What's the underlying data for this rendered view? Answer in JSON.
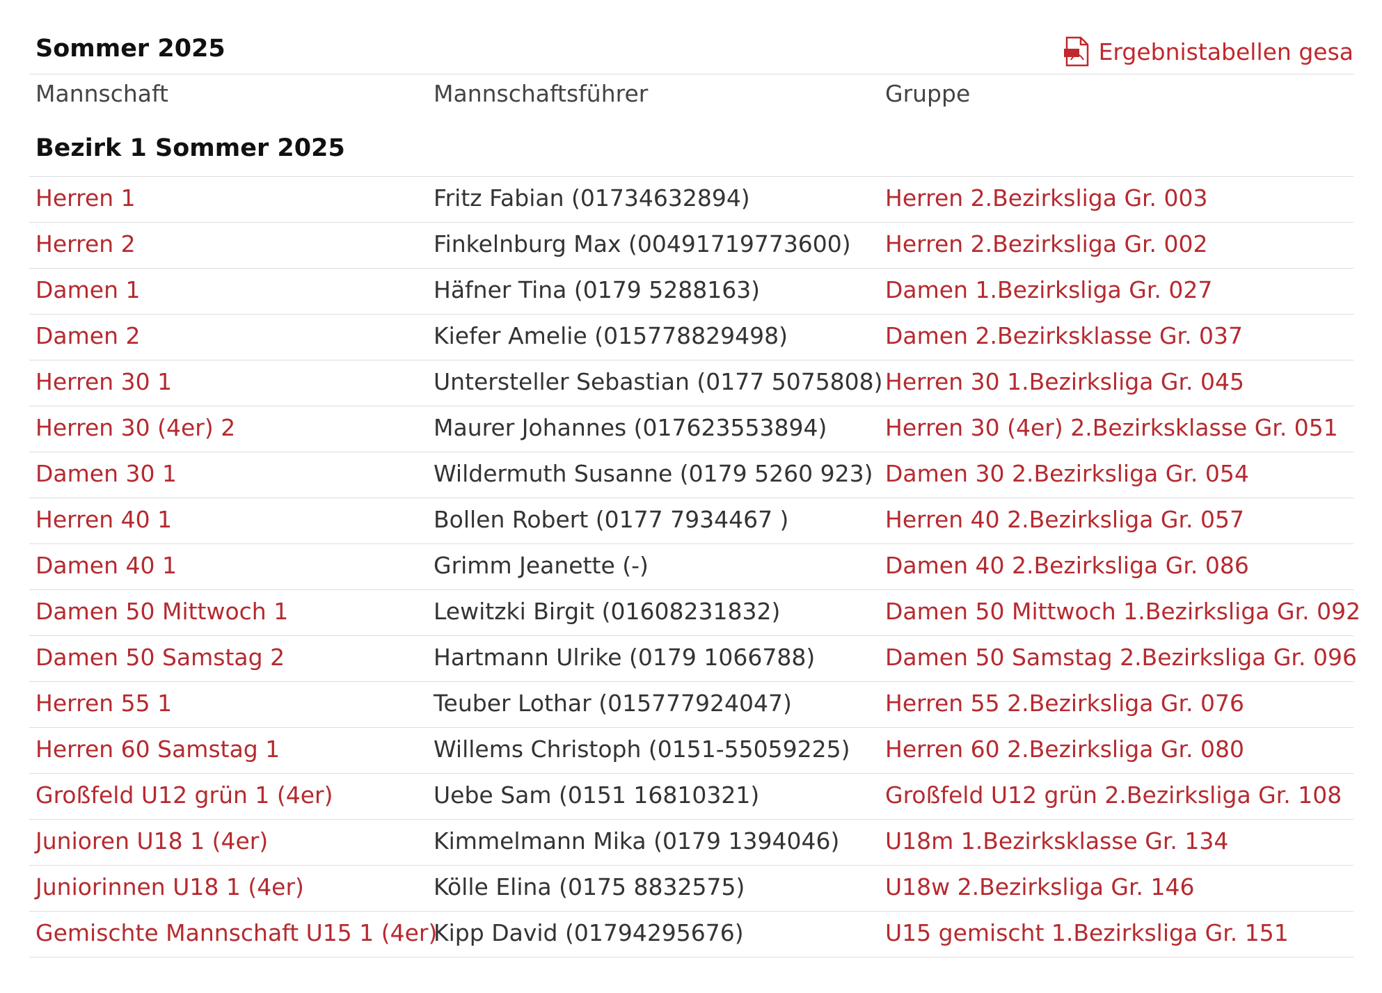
{
  "season": {
    "title": "Sommer 2025",
    "pdf_link_label": "Ergebnistabellen gesa",
    "pdf_icon": "pdf-file-icon"
  },
  "columns": {
    "team": "Mannschaft",
    "captain": "Mannschaftsführer",
    "group": "Gruppe"
  },
  "section": {
    "title": "Bezirk 1 Sommer 2025"
  },
  "rows": [
    {
      "team": "Herren 1",
      "captain": "Fritz Fabian (01734632894)",
      "group": "Herren 2.Bezirksliga Gr. 003"
    },
    {
      "team": "Herren 2",
      "captain": "Finkelnburg Max (00491719773600)",
      "group": "Herren 2.Bezirksliga Gr. 002"
    },
    {
      "team": "Damen 1",
      "captain": "Häfner Tina (0179 5288163)",
      "group": "Damen 1.Bezirksliga Gr. 027"
    },
    {
      "team": "Damen 2",
      "captain": "Kiefer Amelie (015778829498)",
      "group": "Damen 2.Bezirksklasse Gr. 037"
    },
    {
      "team": "Herren 30 1",
      "captain": "Untersteller Sebastian (0177 5075808)",
      "group": "Herren 30 1.Bezirksliga Gr. 045"
    },
    {
      "team": "Herren 30 (4er) 2",
      "captain": "Maurer Johannes (017623553894)",
      "group": "Herren 30 (4er) 2.Bezirksklasse Gr. 051"
    },
    {
      "team": "Damen 30 1",
      "captain": "Wildermuth Susanne (0179 5260 923)",
      "group": "Damen 30 2.Bezirksliga Gr. 054"
    },
    {
      "team": "Herren 40 1",
      "captain": "Bollen Robert (0177 7934467 )",
      "group": "Herren 40 2.Bezirksliga Gr. 057"
    },
    {
      "team": "Damen 40 1",
      "captain": "Grimm Jeanette (-)",
      "group": "Damen 40 2.Bezirksliga Gr. 086"
    },
    {
      "team": "Damen 50 Mittwoch 1",
      "captain": "Lewitzki Birgit (01608231832)",
      "group": "Damen 50 Mittwoch 1.Bezirksliga Gr. 092"
    },
    {
      "team": "Damen 50 Samstag 2",
      "captain": "Hartmann Ulrike (0179 1066788)",
      "group": "Damen 50 Samstag 2.Bezirksliga Gr. 096"
    },
    {
      "team": "Herren 55 1",
      "captain": "Teuber Lothar (015777924047)",
      "group": "Herren 55 2.Bezirksliga Gr. 076"
    },
    {
      "team": "Herren 60 Samstag 1",
      "captain": "Willems Christoph (0151-55059225)",
      "group": "Herren 60 2.Bezirksliga Gr. 080"
    },
    {
      "team": "Großfeld U12 grün 1 (4er)",
      "captain": "Uebe Sam (0151 16810321)",
      "group": "Großfeld U12 grün 2.Bezirksliga Gr. 108"
    },
    {
      "team": "Junioren U18 1 (4er)",
      "captain": "Kimmelmann Mika (0179 1394046)",
      "group": "U18m 1.Bezirksklasse Gr. 134"
    },
    {
      "team": "Juniorinnen U18 1 (4er)",
      "captain": "Kölle Elina (0175 8832575)",
      "group": "U18w 2.Bezirksliga Gr. 146"
    },
    {
      "team": "Gemischte Mannschaft U15 1 (4er)",
      "captain": "Kipp David (01794295676)",
      "group": "U15 gemischt 1.Bezirksliga Gr. 151"
    }
  ]
}
